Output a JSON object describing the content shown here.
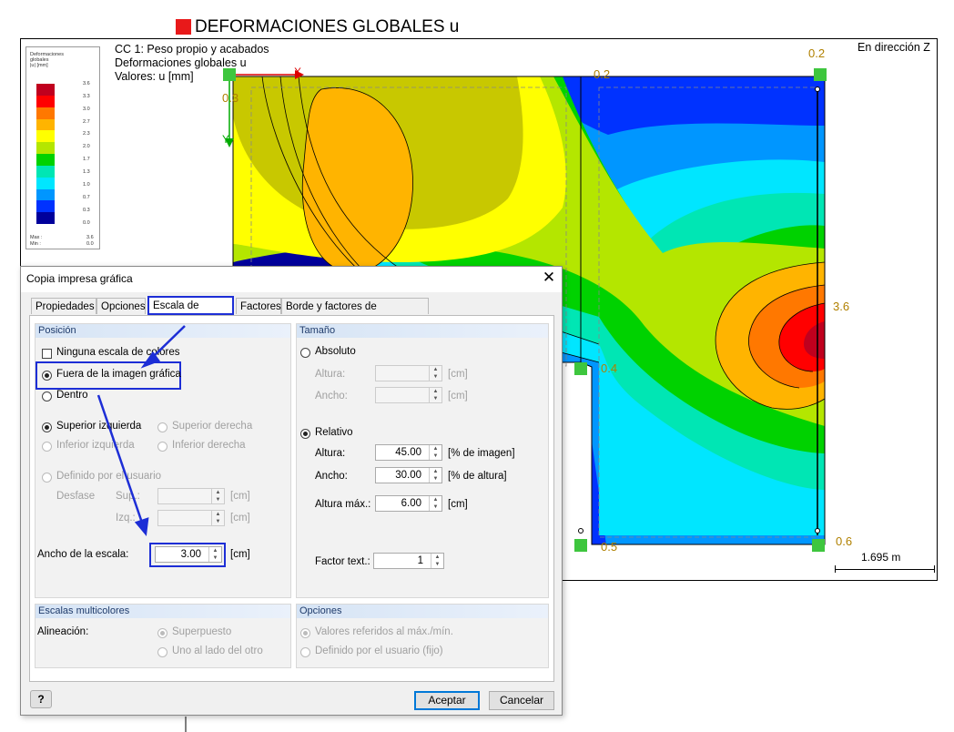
{
  "page": {
    "title": "DEFORMACIONES GLOBALES u"
  },
  "plot": {
    "header": [
      "CC 1: Peso propio y acabados",
      "Deformaciones globales u",
      "Valores: u [mm]"
    ],
    "direction": "En dirección Z",
    "axis_x": "X",
    "axis_y": "Y",
    "node_values": [
      "0.2",
      "0.2",
      "0.3",
      "3.6",
      "0.4",
      "0.5",
      "0.6"
    ],
    "scale_label": "1.695 m",
    "legend": {
      "title_lines": [
        "Deformaciones",
        "globales",
        "|u| [mm]"
      ],
      "ticks": [
        "3.6",
        "3.3",
        "3.0",
        "2.7",
        "2.3",
        "2.0",
        "1.7",
        "1.3",
        "1.0",
        "0.7",
        "0.3",
        "0.0"
      ],
      "colors": [
        "#c0001e",
        "#ff0000",
        "#ff7800",
        "#ffb400",
        "#ffff00",
        "#b4e600",
        "#00d200",
        "#00e6b4",
        "#00e6ff",
        "#0096ff",
        "#0032ff",
        "#00009b"
      ],
      "max_label": "Max :",
      "max_value": "3.6",
      "min_label": "Min :",
      "min_value": "0.0"
    }
  },
  "dialog": {
    "title": "Copia impresa gráfica",
    "close": "✕",
    "tabs": [
      "Propiedades",
      "Opciones",
      "Escala de colores",
      "Factores",
      "Borde y factores de estiramiento"
    ],
    "active_tab": "Escala de colores",
    "position": {
      "header": "Posición",
      "no_scale": "Ninguna escala de colores",
      "outside": "Fuera de la imagen gráfica",
      "inside": "Dentro",
      "top_left": "Superior izquierda",
      "top_right": "Superior derecha",
      "bottom_left": "Inferior izquierda",
      "bottom_right": "Inferior derecha",
      "user_defined": "Definido por el usuario",
      "offset": "Desfase",
      "sup": "Sup.:",
      "izq": "Izq.:",
      "unit_cm": "[cm]",
      "scale_width_label": "Ancho de la escala:",
      "scale_width_value": "3.00"
    },
    "size": {
      "header": "Tamaño",
      "absolute": "Absoluto",
      "height_label": "Altura:",
      "width_label": "Ancho:",
      "unit_cm": "[cm]",
      "relative": "Relativo",
      "rel_height_label": "Altura:",
      "rel_height_value": "45.00",
      "rel_height_unit": "[% de imagen]",
      "rel_width_label": "Ancho:",
      "rel_width_value": "30.00",
      "rel_width_unit": "[% de altura]",
      "max_height_label": "Altura máx.:",
      "max_height_value": "6.00",
      "max_height_unit": "[cm]",
      "text_factor_label": "Factor text.:",
      "text_factor_value": "1"
    },
    "multicolor": {
      "header": "Escalas multicolores",
      "alignment": "Alineación:",
      "overlay": "Superpuesto",
      "side_by_side": "Uno al lado del otro"
    },
    "options": {
      "header": "Opciones",
      "ref_values": "Valores referidos al máx./mín.",
      "user_fixed": "Definido por el usuario (fijo)"
    },
    "buttons": {
      "help": "?",
      "ok": "Aceptar",
      "cancel": "Cancelar"
    }
  }
}
